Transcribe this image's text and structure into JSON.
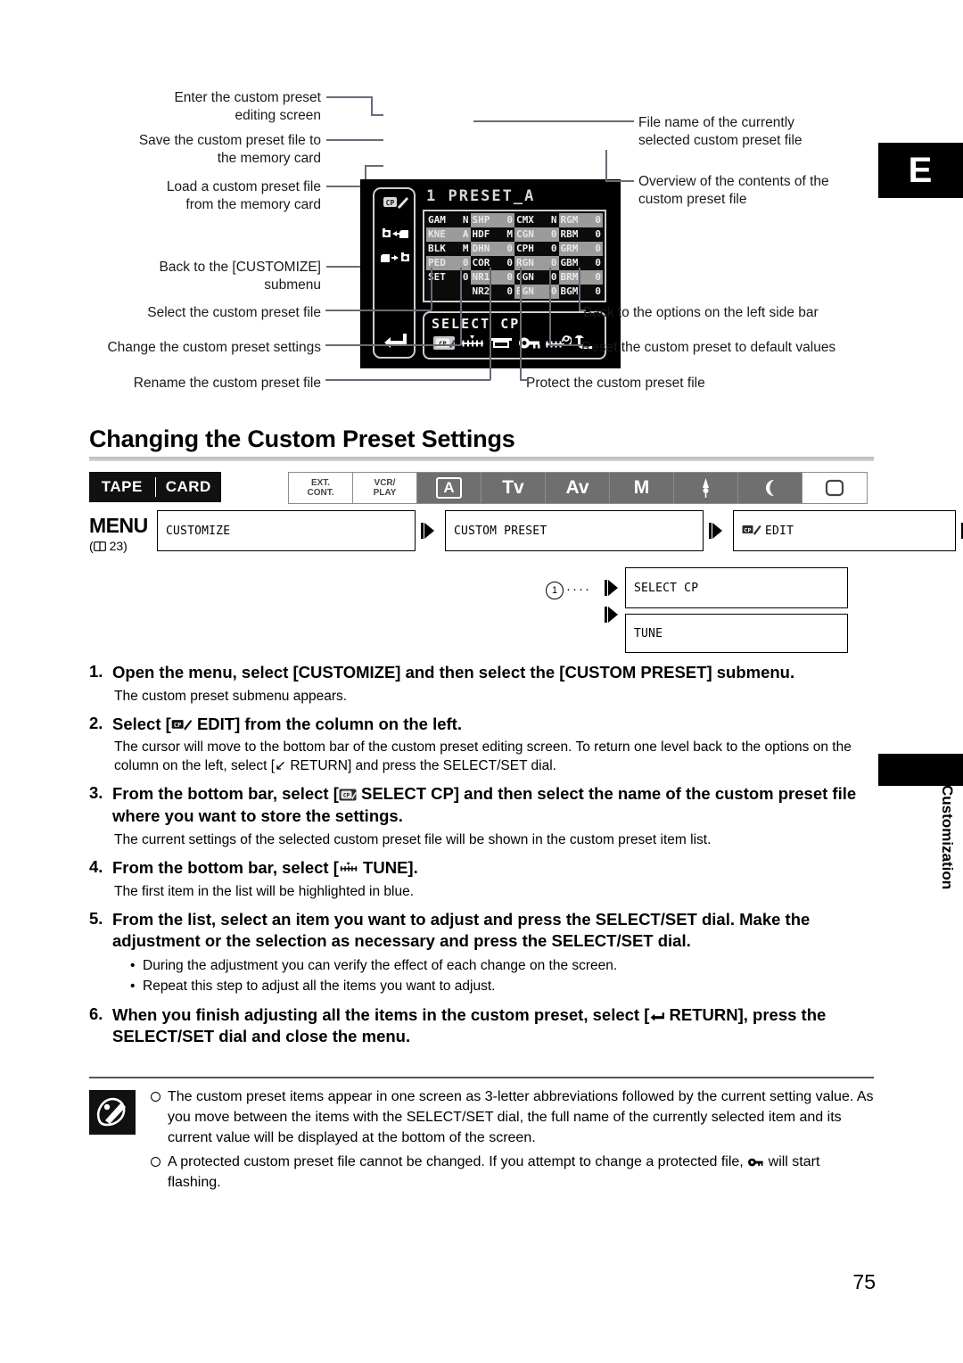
{
  "chapter_tab": {
    "letter": "E"
  },
  "side_tab": {
    "label": "Customization"
  },
  "diagram": {
    "callouts_left": [
      {
        "id": "enter-editing-screen",
        "text": "Enter the custom preset\neditng screen",
        "line1": "Enter the custom preset",
        "line2": "editing screen"
      },
      {
        "id": "save-to-card",
        "line1": "Save the custom preset file to",
        "line2": "the memory card"
      },
      {
        "id": "load-from-card",
        "line1": "Load a custom preset file",
        "line2": "from the memory card"
      },
      {
        "id": "back-to-customize",
        "line1": "Back to the [CUSTOMIZE]",
        "line2": "submenu"
      }
    ],
    "callouts_right": [
      {
        "id": "file-name",
        "line1": "File name of the currently",
        "line2": "selected custom preset file"
      },
      {
        "id": "overview-contents",
        "line1": "Overview of the contents of the",
        "line2": "custom preset file"
      }
    ],
    "callouts_bottom_left": [
      {
        "id": "select-cp",
        "text": "Select the custom preset file"
      },
      {
        "id": "change-settings",
        "text": "Change the custom preset settings"
      },
      {
        "id": "rename-file",
        "text": "Rename the custom preset file"
      }
    ],
    "callouts_bottom_right": [
      {
        "id": "back-to-left-bar",
        "text": "Back to the options on the left side bar"
      },
      {
        "id": "reset-defaults",
        "text": "Reset the custom preset to default values"
      },
      {
        "id": "protect-file",
        "text": "Protect the custom preset file"
      }
    ]
  },
  "lcd": {
    "title": "1 PRESET_A",
    "sidebar_icons": [
      "cp-edit-icon",
      "save-to-card-icon",
      "load-from-card-icon",
      "return-arrow-icon"
    ],
    "bottom_label": "SELECT CP",
    "bottom_icons": [
      "select-cp-icon",
      "tune-icon",
      "rename-icon",
      "protect-key-icon",
      "reset-icon",
      "return-icon"
    ],
    "items": [
      [
        {
          "k": "GAM",
          "v": "N",
          "hl": false
        },
        {
          "k": "SHP",
          "v": "0",
          "hl": true
        },
        {
          "k": "CMX",
          "v": "N",
          "hl": false
        },
        {
          "k": "RGM",
          "v": "0",
          "hl": true
        }
      ],
      [
        {
          "k": "KNE",
          "v": "A",
          "hl": true
        },
        {
          "k": "HDF",
          "v": "M",
          "hl": false
        },
        {
          "k": "CGN",
          "v": "0",
          "hl": true
        },
        {
          "k": "RBM",
          "v": "0",
          "hl": false
        }
      ],
      [
        {
          "k": "BLK",
          "v": "M",
          "hl": false
        },
        {
          "k": "DHN",
          "v": "0",
          "hl": true
        },
        {
          "k": "CPH",
          "v": "0",
          "hl": false
        },
        {
          "k": "GRM",
          "v": "0",
          "hl": true
        }
      ],
      [
        {
          "k": "PED",
          "v": "0",
          "hl": true
        },
        {
          "k": "COR",
          "v": "0",
          "hl": false
        },
        {
          "k": "RGN",
          "v": "0",
          "hl": true
        },
        {
          "k": "GBM",
          "v": "0",
          "hl": false
        }
      ],
      [
        {
          "k": "SET",
          "v": "0",
          "hl": false
        },
        {
          "k": "NR1",
          "v": "0",
          "hl": true
        },
        {
          "k": "GGN",
          "v": "0",
          "hl": false
        },
        {
          "k": "BRM",
          "v": "0",
          "hl": true
        }
      ],
      [
        {
          "k": "",
          "v": "",
          "hl": false,
          "blank": true
        },
        {
          "k": "NR2",
          "v": "0",
          "hl": false
        },
        {
          "k": "BGN",
          "v": "0",
          "hl": true
        },
        {
          "k": "BGM",
          "v": "0",
          "hl": false
        }
      ]
    ]
  },
  "section": {
    "title": "Changing the Custom Preset Settings"
  },
  "mode_bar": {
    "tape": "TAPE",
    "card": "CARD",
    "modes": [
      {
        "label": "EXT.\nCONT.",
        "line1": "EXT.",
        "line2": "CONT.",
        "style": "white"
      },
      {
        "label": "VCR/\nPLAY",
        "line1": "VCR/",
        "line2": "PLAY",
        "style": "white"
      },
      {
        "label": "A",
        "style": "gray-boxed"
      },
      {
        "label": "Tv",
        "style": "gray"
      },
      {
        "label": "Av",
        "style": "gray"
      },
      {
        "label": "M",
        "style": "gray"
      },
      {
        "label": "spotlight-icon",
        "style": "gray"
      },
      {
        "label": "night-icon",
        "style": "gray"
      },
      {
        "label": "easy-recording-icon",
        "style": "white"
      }
    ]
  },
  "menu_flow": {
    "menu_word": "MENU",
    "page_ref": "( 23)",
    "page_num": "23",
    "boxes": [
      {
        "id": "customize",
        "label": "CUSTOMIZE"
      },
      {
        "id": "custom-preset",
        "label": "CUSTOM PRESET"
      },
      {
        "id": "cp-edit",
        "label": "EDIT",
        "icon": "cp-edit-icon"
      },
      {
        "id": "select-cp",
        "label": "SELECT CP"
      },
      {
        "id": "tune",
        "label": "TUNE"
      }
    ],
    "connector_number": "1"
  },
  "steps": [
    {
      "num": "1.",
      "title": "Open the menu, select [CUSTOMIZE] and then select the [CUSTOM PRESET] submenu.",
      "body": "The custom preset submenu appears."
    },
    {
      "num": "2.",
      "title_pre": "Select [",
      "title_icon": "cp-edit-icon",
      "title_post": " EDIT] from the column on the left.",
      "body": "The cursor will move to the bottom bar of the custom preset editing screen. To return one level back to the options on the column on the left, select [↙ RETURN] and press the SELECT/SET dial."
    },
    {
      "num": "3.",
      "title_pre": "From the bottom bar, select [",
      "title_icon": "select-cp-icon",
      "title_post": " SELECT CP] and then select the name of the custom preset file where you want to store the settings.",
      "body": "The current settings of the selected custom preset file will be shown in the custom preset item list."
    },
    {
      "num": "4.",
      "title_pre": "From the bottom bar, select [",
      "title_icon": "tune-icon",
      "title_post": " TUNE].",
      "body": "The first item in the list will be highlighted in blue."
    },
    {
      "num": "5.",
      "title": "From the list, select an item you want to adjust and press the SELECT/SET dial. Make the adjustment or the selection as necessary and press the SELECT/SET dial.",
      "bullets": [
        "During the adjustment you can verify the effect of each change on the screen.",
        "Repeat this step to adjust all the items you want to adjust."
      ]
    },
    {
      "num": "6.",
      "title_pre": "When you finish adjusting all the items in the custom preset, select [",
      "title_icon": "return-arrow-icon",
      "title_post": " RETURN], press the SELECT/SET dial and close the menu."
    }
  ],
  "notes": {
    "icon": "note-pencil-icon",
    "items": [
      {
        "pre": "The custom preset items appear in one screen as 3-letter abbreviations followed by the current setting value. As you move between the items with the SELECT/SET dial, the full name of the currently selected item and its current value will be displayed at the bottom of the screen."
      },
      {
        "pre": "A protected custom preset file cannot be changed. If you attempt to change a protected file, ",
        "icon": "protect-key-icon",
        "post": " will start flashing."
      }
    ]
  },
  "page_number": "75"
}
